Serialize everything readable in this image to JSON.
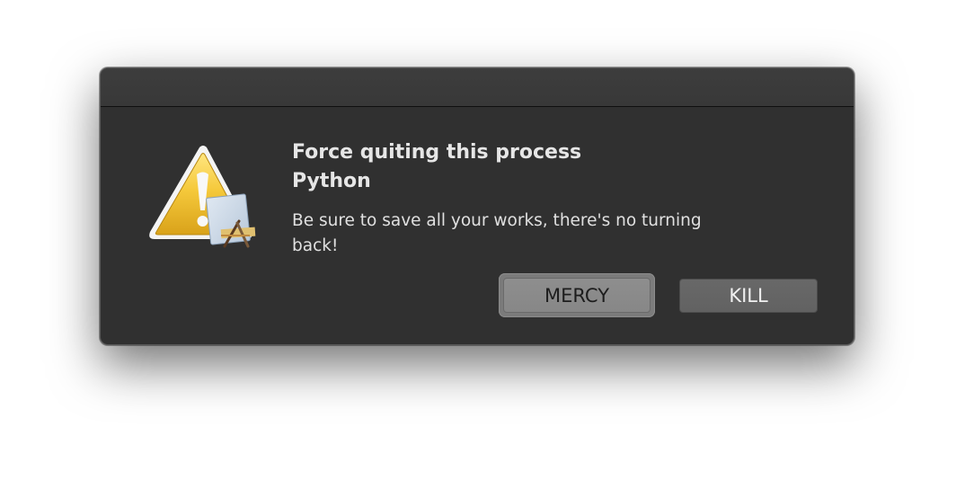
{
  "dialog": {
    "title_line1": "Force quiting this process",
    "title_line2": "Python",
    "message": "Be sure to save all your works, there's no turning back!",
    "icon": "warning-triangle-with-app-icon",
    "buttons": {
      "mercy_label": "MERCY",
      "kill_label": "KILL"
    }
  },
  "colors": {
    "dialog_background": "#303030",
    "title_text": "#e6e6e6",
    "warning_yellow": "#f2c230",
    "default_button": "#878787",
    "secondary_button": "#626262"
  }
}
